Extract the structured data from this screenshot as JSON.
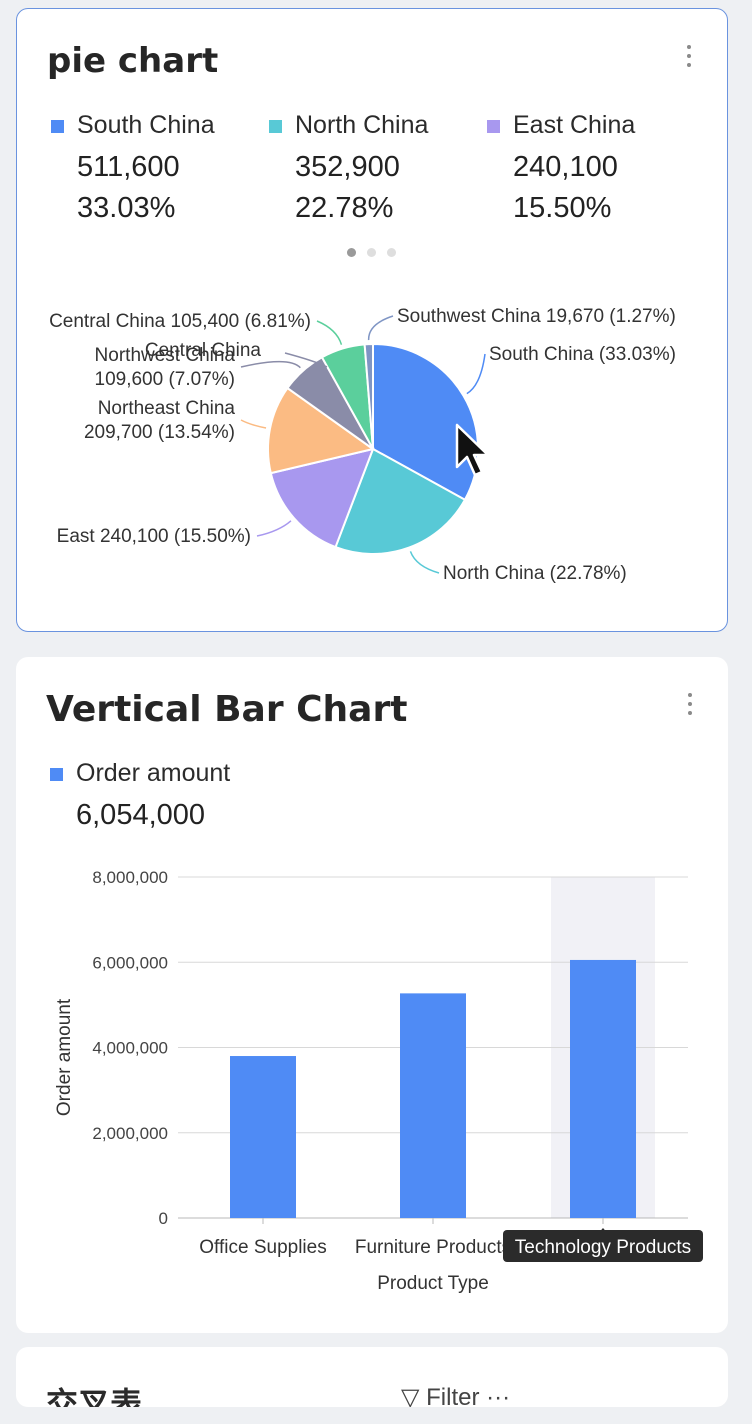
{
  "pie_card": {
    "title": "pie chart",
    "legend": [
      {
        "name": "South China",
        "value": "511,600",
        "percent": "33.03%",
        "color": "#4f8bf5"
      },
      {
        "name": "North China",
        "value": "352,900",
        "percent": "22.78%",
        "color": "#58c9d6"
      },
      {
        "name": "East China",
        "value": "240,100",
        "percent": "15.50%",
        "color": "#a898ef"
      }
    ],
    "pager": {
      "count": 3,
      "active": 0
    }
  },
  "bar_card": {
    "title": "Vertical Bar Chart",
    "legend": {
      "name": "Order amount",
      "total": "6,054,000",
      "color": "#4f8bf5"
    },
    "tooltip": "Technology Products"
  },
  "third_card": {
    "title": "交叉表",
    "filter_label": "Filter ···"
  },
  "chart_data": [
    {
      "type": "pie",
      "title": "pie chart",
      "slices": [
        {
          "name": "South China",
          "value": 511600,
          "percent": 33.03,
          "color": "#4f8bf5",
          "label": "South China (33.03%)"
        },
        {
          "name": "North China",
          "value": 352900,
          "percent": 22.78,
          "color": "#58c9d6",
          "label": "North China (22.78%)"
        },
        {
          "name": "East China",
          "value": 240100,
          "percent": 15.5,
          "color": "#a898ef",
          "label": "East 240,100 (15.50%)"
        },
        {
          "name": "Northeast China",
          "value": 209700,
          "percent": 13.54,
          "color": "#fbbb83",
          "label": "Northeast China 209,700 (13.54%)"
        },
        {
          "name": "Northwest China",
          "value": 109600,
          "percent": 7.07,
          "color": "#8a8ca8",
          "label": "Northwest China 109,600 (7.07%)"
        },
        {
          "name": "Central China",
          "value": 105400,
          "percent": 6.81,
          "color": "#5bcf9c",
          "label": "Central China 105,400 (6.81%)"
        },
        {
          "name": "Southwest China",
          "value": 19670,
          "percent": 1.27,
          "color": "#7f95c4",
          "label": "Southwest China 19,670 (1.27%)"
        }
      ],
      "extra_label": "Central China"
    },
    {
      "type": "bar",
      "title": "Vertical Bar Chart",
      "categories": [
        "Office Supplies",
        "Furniture Products",
        "Technology Products"
      ],
      "series": [
        {
          "name": "Order amount",
          "values": [
            3800000,
            5270000,
            6054000
          ],
          "color": "#4f8bf5"
        }
      ],
      "xlabel": "Product Type",
      "ylabel": "Order amount",
      "ylim": [
        0,
        8000000
      ],
      "yticks": [
        0,
        2000000,
        4000000,
        6000000,
        8000000
      ],
      "ytick_labels": [
        "0",
        "2,000,000",
        "4,000,000",
        "6,000,000",
        "8,000,000"
      ],
      "highlighted_index": 2,
      "grid": true
    }
  ]
}
